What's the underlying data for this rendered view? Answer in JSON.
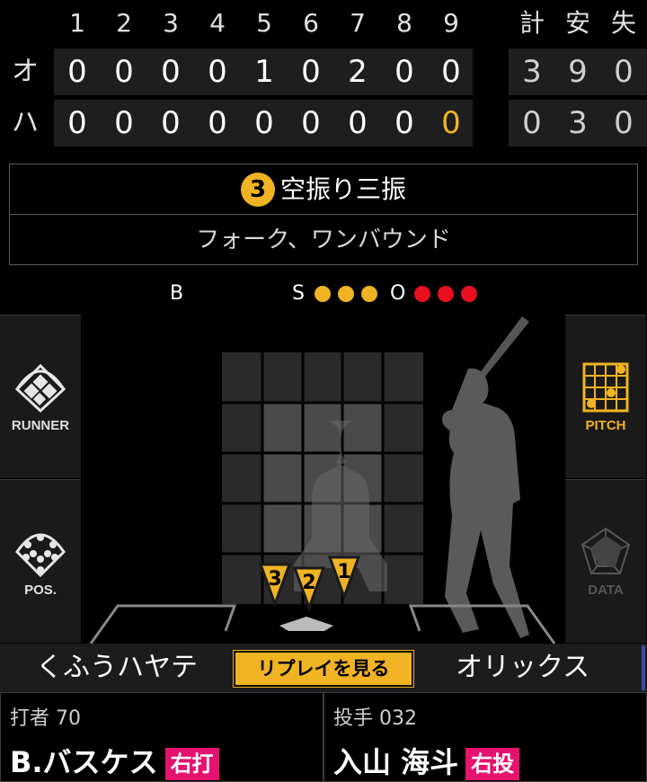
{
  "scoreboard": {
    "innings": [
      "1",
      "2",
      "3",
      "4",
      "5",
      "6",
      "7",
      "8",
      "9"
    ],
    "total_headers": [
      "計",
      "安",
      "失"
    ],
    "rows": [
      {
        "team": "オ",
        "scores": [
          "0",
          "0",
          "0",
          "0",
          "1",
          "0",
          "2",
          "0",
          "0"
        ],
        "totals": [
          "3",
          "9",
          "0"
        ]
      },
      {
        "team": "ハ",
        "scores": [
          "0",
          "0",
          "0",
          "0",
          "0",
          "0",
          "0",
          "0",
          "0"
        ],
        "totals": [
          "0",
          "3",
          "0"
        ]
      }
    ],
    "current_color": "#f0b323"
  },
  "play": {
    "number": "3",
    "result": "空振り三振",
    "detail": "フォーク、ワンバウンド"
  },
  "count": {
    "ball_label": "B",
    "balls": 0,
    "strike_label": "S",
    "strikes": 3,
    "out_label": "O",
    "outs": 3
  },
  "side_panels": {
    "runner": {
      "label": "RUNNER",
      "icon": "diamond-field-icon"
    },
    "pos": {
      "label": "POS.",
      "icon": "field-positions-icon"
    },
    "pitch": {
      "label": "PITCH",
      "icon": "pitch-grid-icon",
      "active": true
    },
    "data": {
      "label": "DATA",
      "icon": "radar-chart-icon",
      "active": false
    }
  },
  "pitches": [
    {
      "label": "3",
      "zone_col": 1,
      "zone_row": 4.5
    },
    {
      "label": "2",
      "zone_col": 1.5,
      "zone_row": 4.5
    },
    {
      "label": "1",
      "zone_col": 2.2,
      "zone_row": 4.5
    }
  ],
  "bottom": {
    "home_team": "くふうハヤテ",
    "replay_label": "リプレイを見る",
    "away_team": "オリックス"
  },
  "batter": {
    "role_label": "打者 70",
    "name": "B.バスケス",
    "hand": "右打"
  },
  "pitcher": {
    "role_label": "投手 032",
    "name": "入山 海斗",
    "hand": "右投"
  },
  "colors": {
    "accent": "#f0b323",
    "out": "#e8101e",
    "badge": "#e5126e"
  }
}
